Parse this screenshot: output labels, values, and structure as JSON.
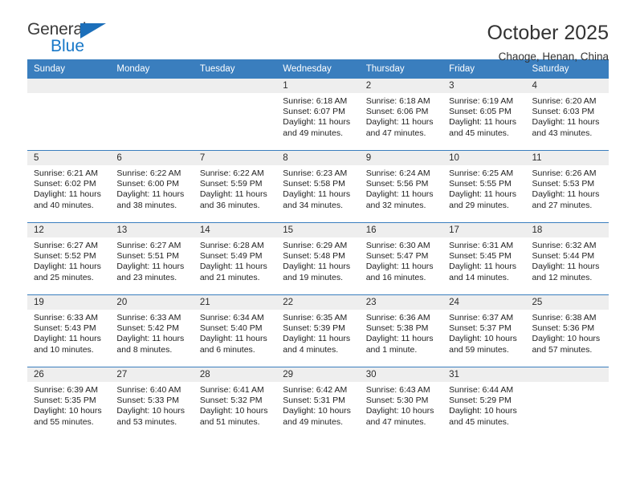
{
  "brand": {
    "name_part1": "General",
    "name_part2": "Blue",
    "accent_color": "#1878c8",
    "header_color": "#3a7ebe"
  },
  "header": {
    "title": "October 2025",
    "subtitle": "Chaoge, Henan, China"
  },
  "weekdays": [
    "Sunday",
    "Monday",
    "Tuesday",
    "Wednesday",
    "Thursday",
    "Friday",
    "Saturday"
  ],
  "weeks": [
    [
      {
        "day": "",
        "lines": []
      },
      {
        "day": "",
        "lines": []
      },
      {
        "day": "",
        "lines": []
      },
      {
        "day": "1",
        "lines": [
          "Sunrise: 6:18 AM",
          "Sunset: 6:07 PM",
          "Daylight: 11 hours and 49 minutes."
        ]
      },
      {
        "day": "2",
        "lines": [
          "Sunrise: 6:18 AM",
          "Sunset: 6:06 PM",
          "Daylight: 11 hours and 47 minutes."
        ]
      },
      {
        "day": "3",
        "lines": [
          "Sunrise: 6:19 AM",
          "Sunset: 6:05 PM",
          "Daylight: 11 hours and 45 minutes."
        ]
      },
      {
        "day": "4",
        "lines": [
          "Sunrise: 6:20 AM",
          "Sunset: 6:03 PM",
          "Daylight: 11 hours and 43 minutes."
        ]
      }
    ],
    [
      {
        "day": "5",
        "lines": [
          "Sunrise: 6:21 AM",
          "Sunset: 6:02 PM",
          "Daylight: 11 hours and 40 minutes."
        ]
      },
      {
        "day": "6",
        "lines": [
          "Sunrise: 6:22 AM",
          "Sunset: 6:00 PM",
          "Daylight: 11 hours and 38 minutes."
        ]
      },
      {
        "day": "7",
        "lines": [
          "Sunrise: 6:22 AM",
          "Sunset: 5:59 PM",
          "Daylight: 11 hours and 36 minutes."
        ]
      },
      {
        "day": "8",
        "lines": [
          "Sunrise: 6:23 AM",
          "Sunset: 5:58 PM",
          "Daylight: 11 hours and 34 minutes."
        ]
      },
      {
        "day": "9",
        "lines": [
          "Sunrise: 6:24 AM",
          "Sunset: 5:56 PM",
          "Daylight: 11 hours and 32 minutes."
        ]
      },
      {
        "day": "10",
        "lines": [
          "Sunrise: 6:25 AM",
          "Sunset: 5:55 PM",
          "Daylight: 11 hours and 29 minutes."
        ]
      },
      {
        "day": "11",
        "lines": [
          "Sunrise: 6:26 AM",
          "Sunset: 5:53 PM",
          "Daylight: 11 hours and 27 minutes."
        ]
      }
    ],
    [
      {
        "day": "12",
        "lines": [
          "Sunrise: 6:27 AM",
          "Sunset: 5:52 PM",
          "Daylight: 11 hours and 25 minutes."
        ]
      },
      {
        "day": "13",
        "lines": [
          "Sunrise: 6:27 AM",
          "Sunset: 5:51 PM",
          "Daylight: 11 hours and 23 minutes."
        ]
      },
      {
        "day": "14",
        "lines": [
          "Sunrise: 6:28 AM",
          "Sunset: 5:49 PM",
          "Daylight: 11 hours and 21 minutes."
        ]
      },
      {
        "day": "15",
        "lines": [
          "Sunrise: 6:29 AM",
          "Sunset: 5:48 PM",
          "Daylight: 11 hours and 19 minutes."
        ]
      },
      {
        "day": "16",
        "lines": [
          "Sunrise: 6:30 AM",
          "Sunset: 5:47 PM",
          "Daylight: 11 hours and 16 minutes."
        ]
      },
      {
        "day": "17",
        "lines": [
          "Sunrise: 6:31 AM",
          "Sunset: 5:45 PM",
          "Daylight: 11 hours and 14 minutes."
        ]
      },
      {
        "day": "18",
        "lines": [
          "Sunrise: 6:32 AM",
          "Sunset: 5:44 PM",
          "Daylight: 11 hours and 12 minutes."
        ]
      }
    ],
    [
      {
        "day": "19",
        "lines": [
          "Sunrise: 6:33 AM",
          "Sunset: 5:43 PM",
          "Daylight: 11 hours and 10 minutes."
        ]
      },
      {
        "day": "20",
        "lines": [
          "Sunrise: 6:33 AM",
          "Sunset: 5:42 PM",
          "Daylight: 11 hours and 8 minutes."
        ]
      },
      {
        "day": "21",
        "lines": [
          "Sunrise: 6:34 AM",
          "Sunset: 5:40 PM",
          "Daylight: 11 hours and 6 minutes."
        ]
      },
      {
        "day": "22",
        "lines": [
          "Sunrise: 6:35 AM",
          "Sunset: 5:39 PM",
          "Daylight: 11 hours and 4 minutes."
        ]
      },
      {
        "day": "23",
        "lines": [
          "Sunrise: 6:36 AM",
          "Sunset: 5:38 PM",
          "Daylight: 11 hours and 1 minute."
        ]
      },
      {
        "day": "24",
        "lines": [
          "Sunrise: 6:37 AM",
          "Sunset: 5:37 PM",
          "Daylight: 10 hours and 59 minutes."
        ]
      },
      {
        "day": "25",
        "lines": [
          "Sunrise: 6:38 AM",
          "Sunset: 5:36 PM",
          "Daylight: 10 hours and 57 minutes."
        ]
      }
    ],
    [
      {
        "day": "26",
        "lines": [
          "Sunrise: 6:39 AM",
          "Sunset: 5:35 PM",
          "Daylight: 10 hours and 55 minutes."
        ]
      },
      {
        "day": "27",
        "lines": [
          "Sunrise: 6:40 AM",
          "Sunset: 5:33 PM",
          "Daylight: 10 hours and 53 minutes."
        ]
      },
      {
        "day": "28",
        "lines": [
          "Sunrise: 6:41 AM",
          "Sunset: 5:32 PM",
          "Daylight: 10 hours and 51 minutes."
        ]
      },
      {
        "day": "29",
        "lines": [
          "Sunrise: 6:42 AM",
          "Sunset: 5:31 PM",
          "Daylight: 10 hours and 49 minutes."
        ]
      },
      {
        "day": "30",
        "lines": [
          "Sunrise: 6:43 AM",
          "Sunset: 5:30 PM",
          "Daylight: 10 hours and 47 minutes."
        ]
      },
      {
        "day": "31",
        "lines": [
          "Sunrise: 6:44 AM",
          "Sunset: 5:29 PM",
          "Daylight: 10 hours and 45 minutes."
        ]
      },
      {
        "day": "",
        "lines": []
      }
    ]
  ]
}
